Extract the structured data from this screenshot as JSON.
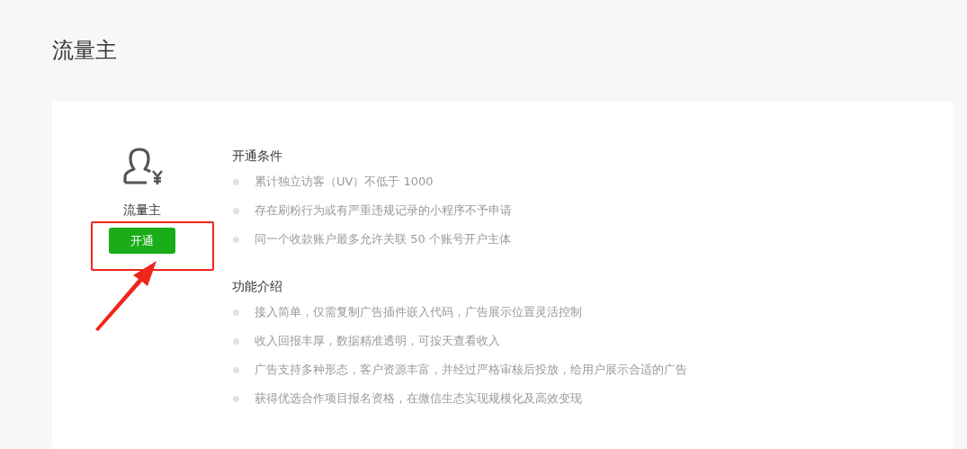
{
  "page_title": "流量主",
  "product": {
    "name": "流量主",
    "button": "开通"
  },
  "sections": [
    {
      "heading": "开通条件",
      "items": [
        "累计独立访客（UV）不低于 1000",
        "存在刷粉行为或有严重违规记录的小程序不予申请",
        "同一个收款账户最多允许关联 50 个账号开户主体"
      ]
    },
    {
      "heading": "功能介绍",
      "items": [
        "接入简单，仅需复制广告插件嵌入代码，广告展示位置灵活控制",
        "收入回报丰厚，数据精准透明，可按天查看收入",
        "广告支持多种形态，客户资源丰富，并经过严格审核后投放，给用户展示合适的广告",
        "获得优选合作项目报名资格，在微信生态实现规模化及高效变现"
      ]
    }
  ]
}
